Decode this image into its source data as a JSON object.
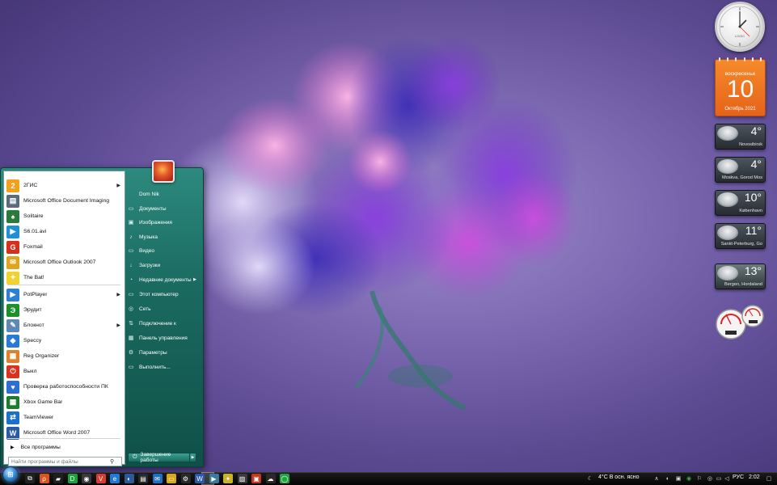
{
  "start_menu": {
    "programs": [
      {
        "label": "2ГИС",
        "icon": "2gis-icon",
        "color": "#f2a020",
        "glyph": "2",
        "submenu": true
      },
      {
        "label": "Microsoft Office Document Imaging",
        "icon": "office-imaging-icon",
        "color": "#5a6b7e",
        "glyph": "▤",
        "submenu": false
      },
      {
        "label": "Solitaire",
        "icon": "solitaire-icon",
        "color": "#2a7a3c",
        "glyph": "♠",
        "submenu": false
      },
      {
        "label": "S6.01.avi",
        "icon": "video-file-icon",
        "color": "#1f8fd6",
        "glyph": "▶",
        "submenu": false
      },
      {
        "label": "Foxmail",
        "icon": "foxmail-icon",
        "color": "#d6301c",
        "glyph": "G",
        "submenu": false
      },
      {
        "label": "Microsoft Office Outlook 2007",
        "icon": "outlook-icon",
        "color": "#e0a51c",
        "glyph": "✉",
        "submenu": false
      },
      {
        "label": "The Bat!",
        "icon": "the-bat-icon",
        "color": "#f2d22e",
        "glyph": "✦",
        "submenu": false
      },
      {
        "label": "PotPlayer",
        "icon": "potplayer-icon",
        "color": "#2d7fd4",
        "glyph": "▶",
        "submenu": true
      },
      {
        "label": "Эрудит",
        "icon": "erudit-icon",
        "color": "#1f8f2e",
        "glyph": "Э",
        "submenu": false
      },
      {
        "label": "Блокнот",
        "icon": "notepad-icon",
        "color": "#5f87b8",
        "glyph": "✎",
        "submenu": true
      },
      {
        "label": "Speccy",
        "icon": "speccy-icon",
        "color": "#2b7ad1",
        "glyph": "◆",
        "submenu": false
      },
      {
        "label": "Reg Organizer",
        "icon": "reg-organizer-icon",
        "color": "#e0802a",
        "glyph": "▦",
        "submenu": false
      },
      {
        "label": "Выкл",
        "icon": "power-off-icon",
        "color": "#d9331f",
        "glyph": "⏻",
        "submenu": false
      },
      {
        "label": "Проверка работоспособности ПК",
        "icon": "pc-health-icon",
        "color": "#2b6fd6",
        "glyph": "♥",
        "submenu": false
      },
      {
        "label": "Xbox Game Bar",
        "icon": "xbox-game-bar-icon",
        "color": "#1f7a2f",
        "glyph": "▦",
        "submenu": false
      },
      {
        "label": "TeamViewer",
        "icon": "teamviewer-icon",
        "color": "#1a6fd1",
        "glyph": "⇄",
        "submenu": false
      },
      {
        "label": "Microsoft Office Word 2007",
        "icon": "word-icon",
        "color": "#2a5aa8",
        "glyph": "W",
        "submenu": false
      }
    ],
    "all_programs_label": "Все программы",
    "search_placeholder": "Найти программы и файлы",
    "places": [
      {
        "label": "Dom Nik",
        "icon": "user-folder-icon",
        "glyph": "",
        "submenu": false
      },
      {
        "label": "Документы",
        "icon": "documents-icon",
        "glyph": "▭",
        "submenu": false
      },
      {
        "label": "Изображения",
        "icon": "pictures-icon",
        "glyph": "▣",
        "submenu": false
      },
      {
        "label": "Музыка",
        "icon": "music-icon",
        "glyph": "♪",
        "submenu": false
      },
      {
        "label": "Видео",
        "icon": "video-icon",
        "glyph": "▭",
        "submenu": false
      },
      {
        "label": "Загрузки",
        "icon": "downloads-icon",
        "glyph": "↓",
        "submenu": false
      },
      {
        "label": "Недавние документы",
        "icon": "recent-documents-icon",
        "glyph": "◔",
        "submenu": true
      },
      {
        "label": "Этот компьютер",
        "icon": "computer-icon",
        "glyph": "▭",
        "submenu": false
      },
      {
        "label": "Сеть",
        "icon": "network-icon",
        "glyph": "◎",
        "submenu": false
      },
      {
        "label": "Подключение к",
        "icon": "connect-icon",
        "glyph": "⇅",
        "submenu": false
      },
      {
        "label": "Панель управления",
        "icon": "control-panel-icon",
        "glyph": "▦",
        "submenu": false
      },
      {
        "label": "Параметры",
        "icon": "settings-icon",
        "glyph": "⚙",
        "submenu": false
      },
      {
        "label": "Выполнить...",
        "icon": "run-icon",
        "glyph": "▭",
        "submenu": false
      }
    ],
    "shutdown_label": "Завершение работы"
  },
  "gadgets": {
    "calendar": {
      "weekday": "воскресенье",
      "day": "10",
      "month_year": "Октябрь 2021"
    },
    "weather": [
      {
        "temp": "4°",
        "city": "Novosibirsk"
      },
      {
        "temp": "4°",
        "city": "Moskva, Gorod Mos"
      },
      {
        "temp": "10°",
        "city": "København"
      },
      {
        "temp": "11°",
        "city": "Sankt-Peterburg, Go"
      },
      {
        "temp": "13°",
        "city": "Bergen, Hordaland"
      }
    ],
    "clock_brand": "LOGIC"
  },
  "taskbar": {
    "weather_text": "4°C  В осн. ясно",
    "language": "РУС",
    "time": "2:02",
    "pinned": [
      {
        "name": "task-view-icon",
        "color": "#222",
        "glyph": "⧉"
      },
      {
        "name": "search-app-icon",
        "color": "#d9541c",
        "glyph": "ρ"
      },
      {
        "name": "dropbox-icon",
        "color": "#1f1f1f",
        "glyph": "▰"
      },
      {
        "name": "folder-app-icon",
        "color": "#1f9f3a",
        "glyph": "D"
      },
      {
        "name": "chrome-icon",
        "color": "#3a3a3a",
        "glyph": "◉"
      },
      {
        "name": "vivaldi-icon",
        "color": "#d93b2e",
        "glyph": "V"
      },
      {
        "name": "edge-icon",
        "color": "#1f7ad1",
        "glyph": "e"
      },
      {
        "name": "firefox-icon",
        "color": "#2a5a9a",
        "glyph": "◐"
      },
      {
        "name": "store-icon",
        "color": "#2a2a2a",
        "glyph": "▤"
      },
      {
        "name": "mail-icon",
        "color": "#1f6fc4",
        "glyph": "✉"
      },
      {
        "name": "explorer-icon",
        "color": "#d6a820",
        "glyph": "▭"
      },
      {
        "name": "settings-app-icon",
        "color": "#2a2a2a",
        "glyph": "⚙"
      },
      {
        "name": "word-app-icon",
        "color": "#2a5aa8",
        "glyph": "W"
      },
      {
        "name": "media-app-icon",
        "color": "#3a7a9a",
        "glyph": "▶"
      },
      {
        "name": "the-bat-app-icon",
        "color": "#c9b22a",
        "glyph": "✦"
      },
      {
        "name": "theme-app-icon",
        "color": "#3a3a3a",
        "glyph": "▨"
      },
      {
        "name": "mailbox-app-icon",
        "color": "#c23a1c",
        "glyph": "▣"
      },
      {
        "name": "weather-app-icon",
        "color": "#2a2a2a",
        "glyph": "☁"
      },
      {
        "name": "whatsapp-icon",
        "color": "#25a244",
        "glyph": "◯"
      }
    ]
  }
}
